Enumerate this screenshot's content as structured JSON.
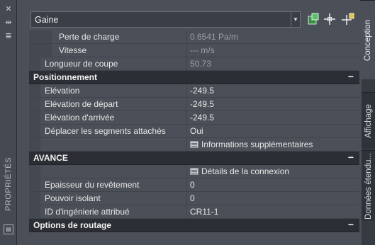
{
  "palette": {
    "panel_bg": "#4b4f57",
    "section_bg": "#2b2e34",
    "strip_bg": "#454a52",
    "text": "#e8e8e8",
    "dim_text": "#9aa0a6"
  },
  "left_strip": {
    "close_icon": "✕",
    "autohide_icon": "⇹",
    "settings_icon": "≣",
    "title": "PROPRIÉTÉS"
  },
  "selector": {
    "value": "Gaine",
    "icons": [
      "quick-select-icon",
      "select-objects-icon",
      "toggle-pickadd-icon"
    ]
  },
  "rows_top": [
    {
      "label": "Perte de charge",
      "value": "0.6541 Pa/m",
      "dim": true,
      "indent": 2
    },
    {
      "label": "Vitesse",
      "value": "--- m/s",
      "dim": true,
      "indent": 2
    },
    {
      "label": "Longueur de coupe",
      "value": "50.73",
      "dim": true,
      "indent": 1
    }
  ],
  "section_positionnement": {
    "title": "Positionnement",
    "collapse": "−",
    "rows": [
      {
        "label": "Elévation",
        "value": "-249.5"
      },
      {
        "label": "Elévation de départ",
        "value": "-249.5"
      },
      {
        "label": "Elévation d'arrivée",
        "value": "-249.5"
      },
      {
        "label": "Déplacer les segments attachés",
        "value": "Oui"
      }
    ],
    "link": "Informations supplémentaires"
  },
  "section_avance": {
    "title": "AVANCE",
    "collapse": "−",
    "link": "Détails de la connexion",
    "rows": [
      {
        "label": "Epaisseur du revêtement",
        "value": "0"
      },
      {
        "label": "Pouvoir isolant",
        "value": "0"
      },
      {
        "label": "ID d'ingénierie attribué",
        "value": "CR11-1"
      }
    ]
  },
  "section_routage": {
    "title": "Options de routage",
    "collapse": "−"
  },
  "tabs": [
    {
      "label": "Conception",
      "active": true
    },
    {
      "label": "Affichage",
      "active": false
    },
    {
      "label": "Données étendu...",
      "active": false
    }
  ]
}
